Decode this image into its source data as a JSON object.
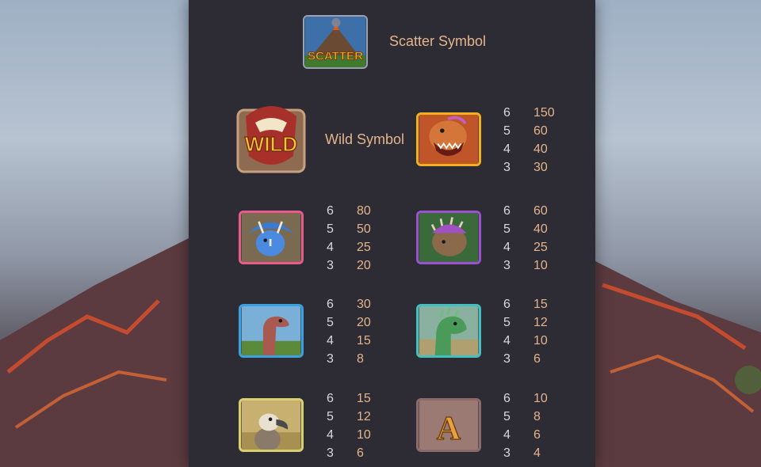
{
  "scatter": {
    "label": "Scatter Symbol",
    "icon": "scatter-volcano-icon",
    "text": "SCATTER"
  },
  "wild": {
    "label": "Wild Symbol",
    "icon": "wild-trex-icon",
    "text": "WILD"
  },
  "colors": {
    "panel": "#2d2c35",
    "label": "#e3b48c",
    "count": "#d8d8dc"
  },
  "symbols": [
    {
      "icon": "trex-icon",
      "pays": [
        {
          "count": "6",
          "value": "150"
        },
        {
          "count": "5",
          "value": "60"
        },
        {
          "count": "4",
          "value": "40"
        },
        {
          "count": "3",
          "value": "30"
        }
      ]
    },
    {
      "icon": "triceratops-icon",
      "pays": [
        {
          "count": "6",
          "value": "80"
        },
        {
          "count": "5",
          "value": "50"
        },
        {
          "count": "4",
          "value": "25"
        },
        {
          "count": "3",
          "value": "20"
        }
      ]
    },
    {
      "icon": "ankylosaurus-icon",
      "pays": [
        {
          "count": "6",
          "value": "60"
        },
        {
          "count": "5",
          "value": "40"
        },
        {
          "count": "4",
          "value": "25"
        },
        {
          "count": "3",
          "value": "10"
        }
      ]
    },
    {
      "icon": "sauropod-icon",
      "pays": [
        {
          "count": "6",
          "value": "30"
        },
        {
          "count": "5",
          "value": "20"
        },
        {
          "count": "4",
          "value": "15"
        },
        {
          "count": "3",
          "value": "8"
        }
      ]
    },
    {
      "icon": "green-dino-icon",
      "pays": [
        {
          "count": "6",
          "value": "15"
        },
        {
          "count": "5",
          "value": "12"
        },
        {
          "count": "4",
          "value": "10"
        },
        {
          "count": "3",
          "value": "6"
        }
      ]
    },
    {
      "icon": "dodo-bird-icon",
      "pays": [
        {
          "count": "6",
          "value": "15"
        },
        {
          "count": "5",
          "value": "12"
        },
        {
          "count": "4",
          "value": "10"
        },
        {
          "count": "3",
          "value": "6"
        }
      ]
    },
    {
      "icon": "letter-a-icon",
      "letter": "A",
      "pays": [
        {
          "count": "6",
          "value": "10"
        },
        {
          "count": "5",
          "value": "8"
        },
        {
          "count": "4",
          "value": "6"
        },
        {
          "count": "3",
          "value": "4"
        }
      ]
    }
  ]
}
